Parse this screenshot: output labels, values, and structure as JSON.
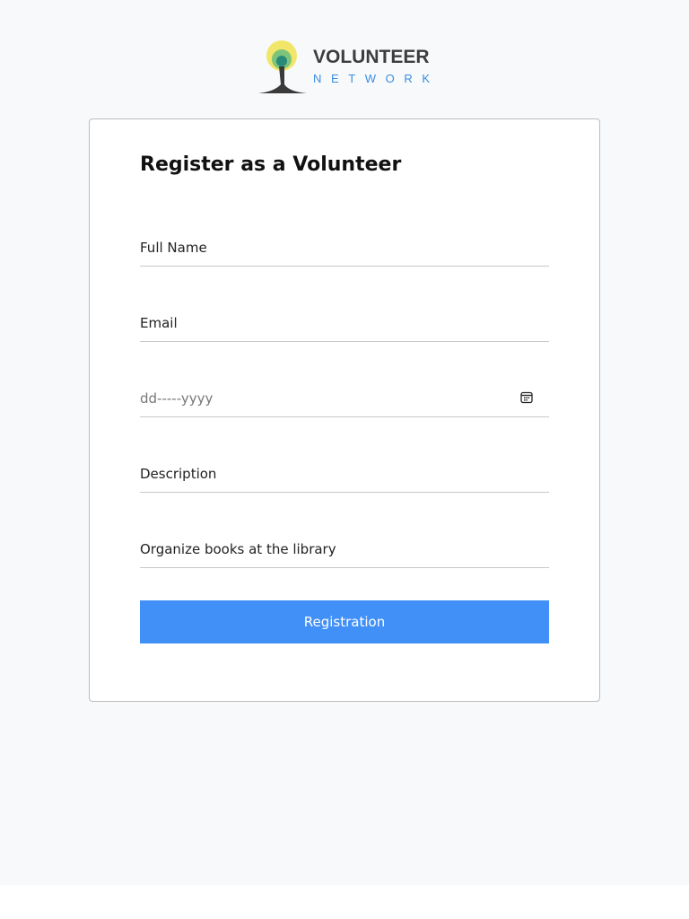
{
  "logo": {
    "line1": "VOLUNTEER",
    "line2": "NETWORK"
  },
  "form": {
    "title": "Register as a Volunteer",
    "full_name_placeholder": "Full Name",
    "email_placeholder": "Email",
    "date_placeholder": "dd-----yyyy",
    "description_placeholder": "Description",
    "task_value": "Organize books at the library",
    "submit_label": "Registration"
  },
  "colors": {
    "accent": "#4090f8",
    "background": "#f8f9fa"
  }
}
